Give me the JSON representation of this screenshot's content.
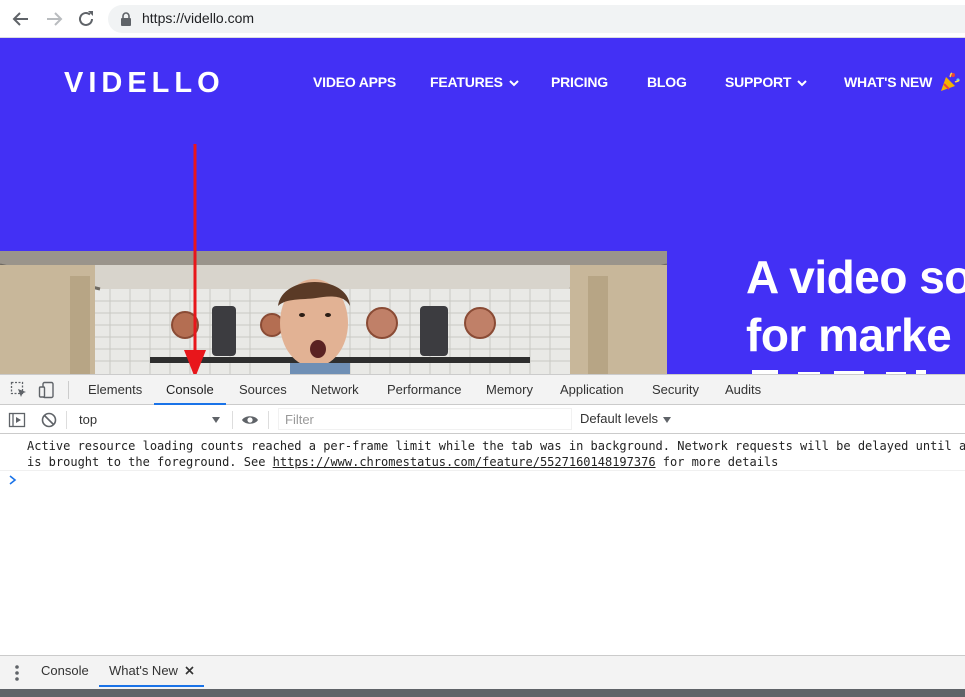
{
  "browser": {
    "url": "https://vidello.com"
  },
  "site": {
    "logo": "VIDELLO",
    "nav": {
      "video_apps": "VIDEO APPS",
      "features": "FEATURES",
      "pricing": "PRICING",
      "blog": "BLOG",
      "support": "SUPPORT",
      "whats_new": "WHAT'S NEW"
    },
    "hero": {
      "line1": "A video so",
      "line2": "for marke"
    }
  },
  "devtools": {
    "tabs": {
      "elements": "Elements",
      "console": "Console",
      "sources": "Sources",
      "network": "Network",
      "performance": "Performance",
      "memory": "Memory",
      "application": "Application",
      "security": "Security",
      "audits": "Audits"
    },
    "active_tab": "Console",
    "toolbar": {
      "context": "top",
      "filter_placeholder": "Filter",
      "levels": "Default levels"
    },
    "message": {
      "line1": "Active resource loading counts reached a per-frame limit while the tab was in background. Network requests will be delayed until a frame",
      "line2_prefix": "is brought to the foreground. See ",
      "link": "https://www.chromestatus.com/feature/5527160148197376",
      "line2_suffix": " for more details"
    },
    "drawer": {
      "console": "Console",
      "whats_new": "What's New"
    }
  },
  "colors": {
    "site_background": "#4330f5",
    "tab_underline": "#1a73e8",
    "annotation_arrow": "#e8161b"
  }
}
